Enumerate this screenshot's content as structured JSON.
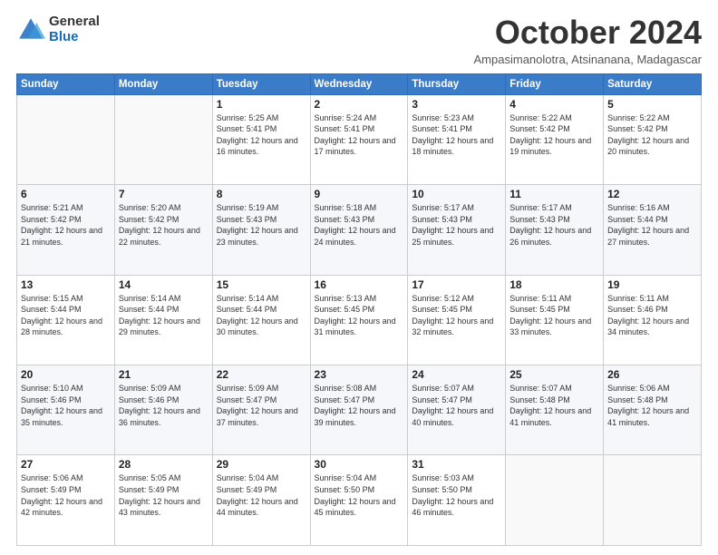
{
  "logo": {
    "general": "General",
    "blue": "Blue"
  },
  "title": {
    "month_year": "October 2024",
    "location": "Ampasimanolotra, Atsinanana, Madagascar"
  },
  "weekdays": [
    "Sunday",
    "Monday",
    "Tuesday",
    "Wednesday",
    "Thursday",
    "Friday",
    "Saturday"
  ],
  "weeks": [
    [
      {
        "day": "",
        "info": ""
      },
      {
        "day": "",
        "info": ""
      },
      {
        "day": "1",
        "info": "Sunrise: 5:25 AM\nSunset: 5:41 PM\nDaylight: 12 hours and 16 minutes."
      },
      {
        "day": "2",
        "info": "Sunrise: 5:24 AM\nSunset: 5:41 PM\nDaylight: 12 hours and 17 minutes."
      },
      {
        "day": "3",
        "info": "Sunrise: 5:23 AM\nSunset: 5:41 PM\nDaylight: 12 hours and 18 minutes."
      },
      {
        "day": "4",
        "info": "Sunrise: 5:22 AM\nSunset: 5:42 PM\nDaylight: 12 hours and 19 minutes."
      },
      {
        "day": "5",
        "info": "Sunrise: 5:22 AM\nSunset: 5:42 PM\nDaylight: 12 hours and 20 minutes."
      }
    ],
    [
      {
        "day": "6",
        "info": "Sunrise: 5:21 AM\nSunset: 5:42 PM\nDaylight: 12 hours and 21 minutes."
      },
      {
        "day": "7",
        "info": "Sunrise: 5:20 AM\nSunset: 5:42 PM\nDaylight: 12 hours and 22 minutes."
      },
      {
        "day": "8",
        "info": "Sunrise: 5:19 AM\nSunset: 5:43 PM\nDaylight: 12 hours and 23 minutes."
      },
      {
        "day": "9",
        "info": "Sunrise: 5:18 AM\nSunset: 5:43 PM\nDaylight: 12 hours and 24 minutes."
      },
      {
        "day": "10",
        "info": "Sunrise: 5:17 AM\nSunset: 5:43 PM\nDaylight: 12 hours and 25 minutes."
      },
      {
        "day": "11",
        "info": "Sunrise: 5:17 AM\nSunset: 5:43 PM\nDaylight: 12 hours and 26 minutes."
      },
      {
        "day": "12",
        "info": "Sunrise: 5:16 AM\nSunset: 5:44 PM\nDaylight: 12 hours and 27 minutes."
      }
    ],
    [
      {
        "day": "13",
        "info": "Sunrise: 5:15 AM\nSunset: 5:44 PM\nDaylight: 12 hours and 28 minutes."
      },
      {
        "day": "14",
        "info": "Sunrise: 5:14 AM\nSunset: 5:44 PM\nDaylight: 12 hours and 29 minutes."
      },
      {
        "day": "15",
        "info": "Sunrise: 5:14 AM\nSunset: 5:44 PM\nDaylight: 12 hours and 30 minutes."
      },
      {
        "day": "16",
        "info": "Sunrise: 5:13 AM\nSunset: 5:45 PM\nDaylight: 12 hours and 31 minutes."
      },
      {
        "day": "17",
        "info": "Sunrise: 5:12 AM\nSunset: 5:45 PM\nDaylight: 12 hours and 32 minutes."
      },
      {
        "day": "18",
        "info": "Sunrise: 5:11 AM\nSunset: 5:45 PM\nDaylight: 12 hours and 33 minutes."
      },
      {
        "day": "19",
        "info": "Sunrise: 5:11 AM\nSunset: 5:46 PM\nDaylight: 12 hours and 34 minutes."
      }
    ],
    [
      {
        "day": "20",
        "info": "Sunrise: 5:10 AM\nSunset: 5:46 PM\nDaylight: 12 hours and 35 minutes."
      },
      {
        "day": "21",
        "info": "Sunrise: 5:09 AM\nSunset: 5:46 PM\nDaylight: 12 hours and 36 minutes."
      },
      {
        "day": "22",
        "info": "Sunrise: 5:09 AM\nSunset: 5:47 PM\nDaylight: 12 hours and 37 minutes."
      },
      {
        "day": "23",
        "info": "Sunrise: 5:08 AM\nSunset: 5:47 PM\nDaylight: 12 hours and 39 minutes."
      },
      {
        "day": "24",
        "info": "Sunrise: 5:07 AM\nSunset: 5:47 PM\nDaylight: 12 hours and 40 minutes."
      },
      {
        "day": "25",
        "info": "Sunrise: 5:07 AM\nSunset: 5:48 PM\nDaylight: 12 hours and 41 minutes."
      },
      {
        "day": "26",
        "info": "Sunrise: 5:06 AM\nSunset: 5:48 PM\nDaylight: 12 hours and 41 minutes."
      }
    ],
    [
      {
        "day": "27",
        "info": "Sunrise: 5:06 AM\nSunset: 5:49 PM\nDaylight: 12 hours and 42 minutes."
      },
      {
        "day": "28",
        "info": "Sunrise: 5:05 AM\nSunset: 5:49 PM\nDaylight: 12 hours and 43 minutes."
      },
      {
        "day": "29",
        "info": "Sunrise: 5:04 AM\nSunset: 5:49 PM\nDaylight: 12 hours and 44 minutes."
      },
      {
        "day": "30",
        "info": "Sunrise: 5:04 AM\nSunset: 5:50 PM\nDaylight: 12 hours and 45 minutes."
      },
      {
        "day": "31",
        "info": "Sunrise: 5:03 AM\nSunset: 5:50 PM\nDaylight: 12 hours and 46 minutes."
      },
      {
        "day": "",
        "info": ""
      },
      {
        "day": "",
        "info": ""
      }
    ]
  ]
}
